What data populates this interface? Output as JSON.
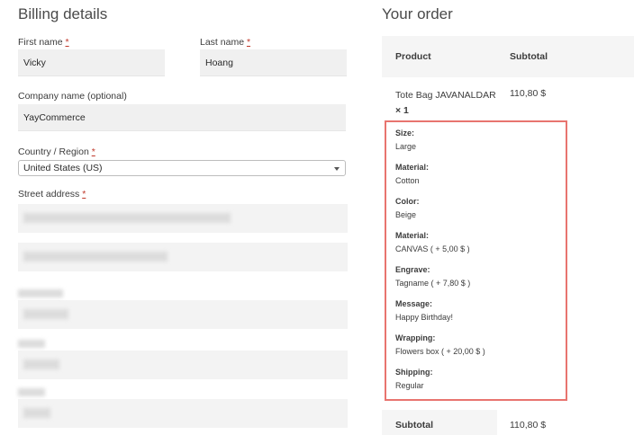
{
  "billing": {
    "title": "Billing details",
    "first_name_label": "First name",
    "first_name_value": "Vicky",
    "last_name_label": "Last name",
    "last_name_value": "Hoang",
    "company_label": "Company name (optional)",
    "company_value": "YayCommerce",
    "country_label": "Country / Region",
    "country_value": "United States (US)",
    "street_label": "Street address",
    "required_mark": "*"
  },
  "order": {
    "title": "Your order",
    "col_product": "Product",
    "col_subtotal": "Subtotal",
    "product_name": "Tote Bag JAVANALDAR",
    "product_qty": "× 1",
    "product_subtotal": "110,80 $",
    "options": [
      {
        "label": "Size:",
        "value": "Large"
      },
      {
        "label": "Material:",
        "value": "Cotton"
      },
      {
        "label": "Color:",
        "value": "Beige"
      },
      {
        "label": "Material:",
        "value": "CANVAS ( + 5,00 $ )"
      },
      {
        "label": "Engrave:",
        "value": "Tagname ( + 7,80 $ )"
      },
      {
        "label": "Message:",
        "value": "Happy Birthday!"
      },
      {
        "label": "Wrapping:",
        "value": "Flowers box ( + 20,00 $ )"
      },
      {
        "label": "Shipping:",
        "value": "Regular"
      }
    ],
    "subtotal_label": "Subtotal",
    "subtotal_value": "110,80 $"
  },
  "colors": {
    "highlight_border": "#e8746f",
    "required": "#c0392b"
  }
}
